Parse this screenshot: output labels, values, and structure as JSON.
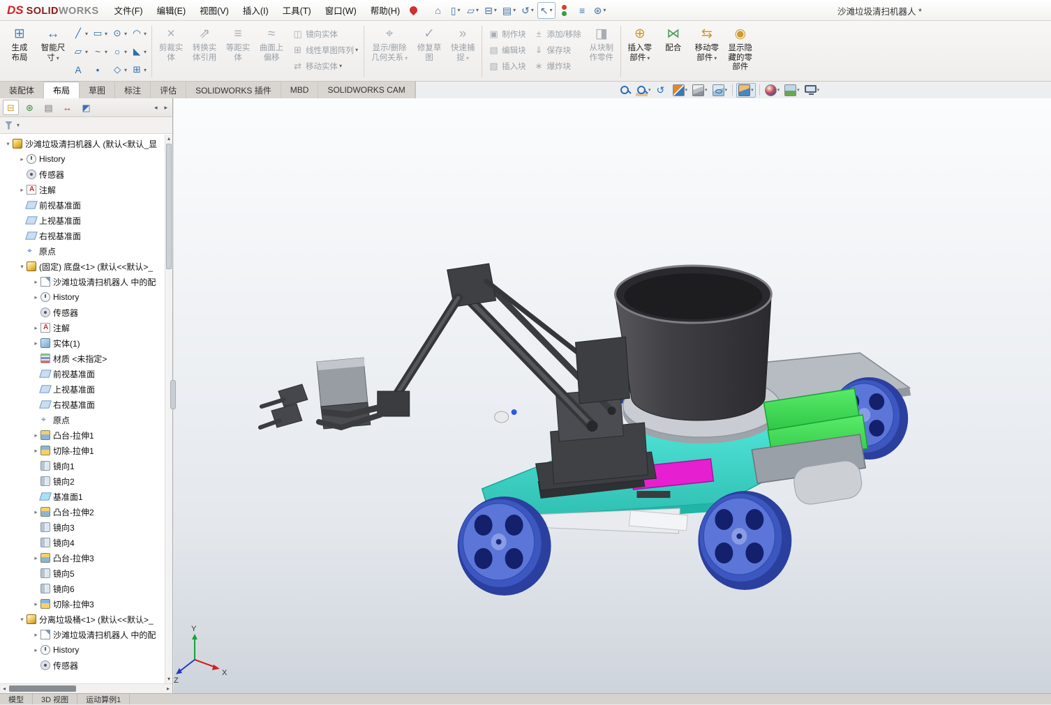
{
  "app": {
    "brand_ds": "DS",
    "brand_solid": "SOLID",
    "brand_works": "WORKS",
    "doc_title": "沙滩垃圾清扫机器人 *"
  },
  "menubar": {
    "menus": [
      {
        "label": "文件(F)"
      },
      {
        "label": "编辑(E)"
      },
      {
        "label": "视图(V)"
      },
      {
        "label": "插入(I)"
      },
      {
        "label": "工具(T)"
      },
      {
        "label": "窗口(W)"
      },
      {
        "label": "帮助(H)"
      }
    ],
    "quick_access": [
      {
        "g": "⌂",
        "name": "home-button"
      },
      {
        "g": "▯",
        "name": "new-document-button",
        "arr": "▾"
      },
      {
        "g": "▱",
        "name": "open-button",
        "arr": "▾"
      },
      {
        "g": "⊟",
        "name": "save-button",
        "arr": "▾"
      },
      {
        "g": "▤",
        "name": "print-button",
        "arr": "▾"
      },
      {
        "g": "↺",
        "name": "undo-button",
        "arr": "▾"
      },
      {
        "g": "↖",
        "name": "select-tool-button",
        "arr": "▾",
        "cls": "pressed"
      },
      {
        "g": "",
        "name": "rebuild-button",
        "cls": "rebuild"
      },
      {
        "g": "≡",
        "name": "bom-button"
      },
      {
        "g": "⊛",
        "name": "options-button",
        "arr": "▾"
      }
    ]
  },
  "ribbon": {
    "layout_group": [
      {
        "lines": [
          "生成",
          "布局"
        ],
        "g": "⊞",
        "color": "#4a86c8",
        "name": "create-layout-button"
      },
      {
        "lines": [
          "智能尺",
          "寸"
        ],
        "g": "↔",
        "color": "#3a77b5",
        "arr": "▾",
        "name": "smart-dimension-button"
      }
    ],
    "sketch_grid": [
      {
        "g": "╱",
        "arr": "▾",
        "name": "line-tool"
      },
      {
        "g": "▭",
        "arr": "▾",
        "name": "rectangle-tool"
      },
      {
        "g": "⊙",
        "arr": "▾",
        "name": "circle-tool"
      },
      {
        "g": "◠",
        "arr": "▾",
        "name": "arc-tool"
      },
      {
        "g": "▱",
        "arr": "▾",
        "name": "polygon-tool"
      },
      {
        "g": "~",
        "arr": "▾",
        "name": "spline-tool"
      },
      {
        "g": "○",
        "arr": "▾",
        "name": "ellipse-tool"
      },
      {
        "g": "◣",
        "arr": "▾",
        "name": "fillet-tool"
      },
      {
        "g": "A",
        "name": "text-tool"
      },
      {
        "g": "•",
        "name": "point-tool"
      },
      {
        "g": "◇",
        "arr": "▾",
        "name": "plane-tool"
      },
      {
        "g": "⊞",
        "arr": "▾",
        "name": "grid-tool"
      }
    ],
    "edit_group": [
      {
        "lines": [
          "剪裁实",
          "体"
        ],
        "g": "×",
        "enabled": false,
        "name": "trim-entities-button"
      },
      {
        "lines": [
          "转换实",
          "体引用"
        ],
        "g": "⇗",
        "enabled": false,
        "name": "convert-entities-button"
      },
      {
        "lines": [
          "等距实",
          "体"
        ],
        "g": "≡",
        "enabled": false,
        "name": "offset-entities-button"
      },
      {
        "lines": [
          "曲面上",
          "偏移"
        ],
        "g": "≈",
        "enabled": false,
        "name": "offset-on-surface-button"
      }
    ],
    "stack_mirror": [
      {
        "label": "镜向实体",
        "g": "◫",
        "enabled": false,
        "name": "mirror-entities-button"
      },
      {
        "label": "线性草图阵列",
        "g": "⊞",
        "enabled": false,
        "arr": "▾",
        "name": "linear-sketch-pattern-button"
      },
      {
        "label": "移动实体",
        "g": "⇄",
        "enabled": false,
        "arr": "▾",
        "name": "move-entities-button"
      }
    ],
    "relations_group": [
      {
        "lines": [
          "显示/删除",
          "几何关系"
        ],
        "g": "⌖",
        "enabled": false,
        "arr": "▾",
        "cls": "wide",
        "name": "display-delete-relations-button"
      },
      {
        "lines": [
          "修复草",
          "图"
        ],
        "g": "✓",
        "enabled": false,
        "name": "repair-sketch-button"
      },
      {
        "lines": [
          "快速捕",
          "捉"
        ],
        "g": "»",
        "enabled": false,
        "arr": "▾",
        "name": "quick-snaps-button"
      }
    ],
    "stack_block1": [
      {
        "label": "制作块",
        "g": "▣",
        "enabled": false,
        "name": "make-block-button"
      },
      {
        "label": "编辑块",
        "g": "▤",
        "enabled": false,
        "name": "edit-block-button"
      },
      {
        "label": "插入块",
        "g": "▧",
        "enabled": false,
        "name": "insert-block-button"
      }
    ],
    "stack_block2": [
      {
        "label": "添加/移除",
        "g": "±",
        "enabled": false,
        "name": "add-remove-button"
      },
      {
        "label": "保存块",
        "g": "⇓",
        "enabled": false,
        "name": "save-block-button"
      },
      {
        "label": "爆炸块",
        "g": "∗",
        "enabled": false,
        "name": "explode-block-button"
      }
    ],
    "block_group": [
      {
        "lines": [
          "从块制",
          "作零件"
        ],
        "g": "◨",
        "enabled": false,
        "name": "make-part-from-block-button"
      }
    ],
    "assembly_group": [
      {
        "lines": [
          "插入零",
          "部件"
        ],
        "g": "⊕",
        "color": "#cf9a2e",
        "arr": "▾",
        "name": "insert-components-button"
      },
      {
        "lines": [
          "配合",
          ""
        ],
        "g": "⋈",
        "color": "#4a9e5c",
        "name": "mate-button"
      },
      {
        "lines": [
          "移动零",
          "部件"
        ],
        "g": "⇆",
        "color": "#cf9a2e",
        "arr": "▾",
        "name": "move-component-button"
      },
      {
        "lines": [
          "显示隐",
          "藏的零",
          "部件"
        ],
        "g": "◉",
        "color": "#cf9a2e",
        "name": "show-hidden-components-button"
      }
    ]
  },
  "command_tabs": [
    {
      "label": "装配体",
      "name": "tab-assembly"
    },
    {
      "label": "布局",
      "active": true,
      "name": "tab-layout"
    },
    {
      "label": "草图",
      "name": "tab-sketch"
    },
    {
      "label": "标注",
      "name": "tab-annotation"
    },
    {
      "label": "评估",
      "name": "tab-evaluate"
    },
    {
      "label": "SOLIDWORKS 插件",
      "name": "tab-addins"
    },
    {
      "label": "MBD",
      "name": "tab-mbd"
    },
    {
      "label": "SOLIDWORKS CAM",
      "name": "tab-cam"
    }
  ],
  "headsup": [
    {
      "icon": "zoom-fit",
      "name": "zoom-to-fit-button"
    },
    {
      "icon": "zoom-area",
      "name": "zoom-to-area-button",
      "arr": "▾"
    },
    {
      "icon": "prev-view",
      "name": "previous-view-button"
    },
    {
      "icon": "section",
      "name": "section-view-button",
      "arr": "▾"
    },
    {
      "icon": "cube-style",
      "name": "display-style-button",
      "arr": "▾"
    },
    {
      "icon": "cube-hide",
      "name": "hide-show-items-button",
      "arr": "▾"
    },
    {
      "cls": "sep",
      "name": "headsup-separator"
    },
    {
      "icon": "view-cube",
      "name": "view-orientation-button",
      "arr": "▾",
      "active": true
    },
    {
      "cls": "sep",
      "name": "headsup-separator"
    },
    {
      "icon": "ball",
      "name": "edit-appearance-button",
      "arr": "▾"
    },
    {
      "icon": "scene",
      "name": "apply-scene-button",
      "arr": "▾"
    },
    {
      "icon": "monitor",
      "name": "view-settings-button",
      "arr": "▾"
    }
  ],
  "panel": {
    "tabs": [
      {
        "g": "⊟",
        "color": "#caa12f",
        "active": true,
        "name": "featuremanager-tab"
      },
      {
        "g": "⊛",
        "color": "#3a8a3a",
        "name": "propertymanager-tab"
      },
      {
        "g": "▤",
        "color": "#7a7a7a",
        "name": "configurationmanager-tab"
      },
      {
        "g": "↔",
        "color": "#b03434",
        "name": "dimxpertmanager-tab"
      },
      {
        "g": "◩",
        "color": "#3a6ec0",
        "name": "displaymanager-tab"
      }
    ],
    "nav_left": "◂",
    "nav_right": "▸",
    "scroll_up": "▴",
    "scroll_down": "▾",
    "hscroll_left": "◂",
    "hscroll_right": "▸"
  },
  "tree": {
    "items": [
      {
        "label": "沙滩垃圾清扫机器人 (默认<默认_显",
        "icon": "assembly",
        "indent": 0,
        "arrow": "▾"
      },
      {
        "label": "History",
        "icon": "history",
        "indent": 1,
        "arrow": "▸"
      },
      {
        "label": "传感器",
        "icon": "sensor",
        "indent": 1,
        "arrow": ""
      },
      {
        "label": "注解",
        "icon": "annotation",
        "indent": 1,
        "arrow": "▸"
      },
      {
        "label": "前视基准面",
        "icon": "plane",
        "indent": 1,
        "arrow": ""
      },
      {
        "label": "上视基准面",
        "icon": "plane",
        "indent": 1,
        "arrow": ""
      },
      {
        "label": "右视基准面",
        "icon": "plane",
        "indent": 1,
        "arrow": ""
      },
      {
        "label": "原点",
        "icon": "origin",
        "indent": 1,
        "arrow": ""
      },
      {
        "label": "(固定) 底盘<1> (默认<<默认>_",
        "icon": "part",
        "indent": 1,
        "arrow": "▾"
      },
      {
        "label": "沙滩垃圾清扫机器人 中的配",
        "icon": "inplace",
        "indent": 2,
        "arrow": "▸"
      },
      {
        "label": "History",
        "icon": "history",
        "indent": 2,
        "arrow": "▸"
      },
      {
        "label": "传感器",
        "icon": "sensor",
        "indent": 2,
        "arrow": ""
      },
      {
        "label": "注解",
        "icon": "annotation",
        "indent": 2,
        "arrow": "▸"
      },
      {
        "label": "实体(1)",
        "icon": "solids",
        "indent": 2,
        "arrow": "▸"
      },
      {
        "label": "材质 <未指定>",
        "icon": "material",
        "indent": 2,
        "arrow": ""
      },
      {
        "label": "前视基准面",
        "icon": "plane",
        "indent": 2,
        "arrow": ""
      },
      {
        "label": "上视基准面",
        "icon": "plane",
        "indent": 2,
        "arrow": ""
      },
      {
        "label": "右视基准面",
        "icon": "plane",
        "indent": 2,
        "arrow": ""
      },
      {
        "label": "原点",
        "icon": "origin",
        "indent": 2,
        "arrow": ""
      },
      {
        "label": "凸台-拉伸1",
        "icon": "boss",
        "indent": 2,
        "arrow": "▸"
      },
      {
        "label": "切除-拉伸1",
        "icon": "cut",
        "indent": 2,
        "arrow": "▸"
      },
      {
        "label": "镜向1",
        "icon": "mirror",
        "indent": 2,
        "arrow": ""
      },
      {
        "label": "镜向2",
        "icon": "mirror",
        "indent": 2,
        "arrow": ""
      },
      {
        "label": "基准面1",
        "icon": "plane2",
        "indent": 2,
        "arrow": ""
      },
      {
        "label": "凸台-拉伸2",
        "icon": "boss",
        "indent": 2,
        "arrow": "▸"
      },
      {
        "label": "镜向3",
        "icon": "mirror",
        "indent": 2,
        "arrow": ""
      },
      {
        "label": "镜向4",
        "icon": "mirror",
        "indent": 2,
        "arrow": ""
      },
      {
        "label": "凸台-拉伸3",
        "icon": "boss",
        "indent": 2,
        "arrow": "▸"
      },
      {
        "label": "镜向5",
        "icon": "mirror",
        "indent": 2,
        "arrow": ""
      },
      {
        "label": "镜向6",
        "icon": "mirror",
        "indent": 2,
        "arrow": ""
      },
      {
        "label": "切除-拉伸3",
        "icon": "cut",
        "indent": 2,
        "arrow": "▸"
      },
      {
        "label": "分离垃圾桶<1> (默认<<默认>_",
        "icon": "part",
        "indent": 1,
        "arrow": "▾"
      },
      {
        "label": "沙滩垃圾清扫机器人 中的配",
        "icon": "inplace",
        "indent": 2,
        "arrow": "▸"
      },
      {
        "label": "History",
        "icon": "history",
        "indent": 2,
        "arrow": "▸"
      },
      {
        "label": "传感器",
        "icon": "sensor",
        "indent": 2,
        "arrow": ""
      }
    ]
  },
  "status_tabs": [
    {
      "label": "模型",
      "name": "model-tab"
    },
    {
      "label": "3D 视图",
      "name": "3d-views-tab"
    },
    {
      "label": "运动算例1",
      "name": "motion-study-tab"
    }
  ],
  "triad": {
    "x": "X",
    "y": "Y",
    "z": "Z"
  }
}
